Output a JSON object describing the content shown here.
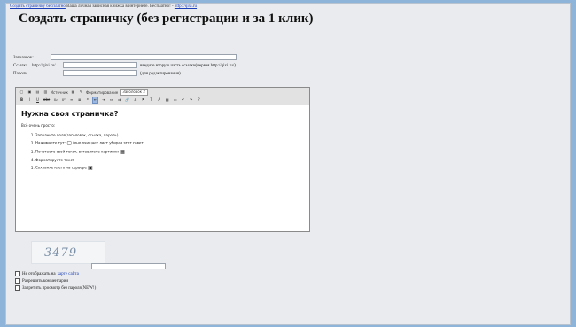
{
  "header": {
    "link1": "Создать страничку бесплатно",
    "tagline": "Ваша личная записная книжка в интернете. Бесплатно! -",
    "site_link": "http://qixi.ru"
  },
  "page_title": "Создать страничку (без регистрации и за 1 клик)",
  "form": {
    "title_label": "Заголовок:",
    "link_label": "Ссылка",
    "link_prefix": "http://qixi.ru/",
    "link_hint": "введите вторую часть ссылки(первая http://qixi.ru/)",
    "password_label": "Пароль",
    "password_hint": "(для редактирования)"
  },
  "toolbar": {
    "row1": {
      "source": "Источник",
      "format_label": "Форматирование",
      "heading_select": "Заголовок 2"
    },
    "row2": [
      "B",
      "I",
      "U",
      "abc",
      "x₂",
      "x²",
      "≡",
      "≣",
      "❝",
      "⇤",
      "⇥",
      "⇔",
      "⇉",
      "🔗",
      "⚓",
      "⚑",
      "T",
      "A",
      "▦",
      "▭",
      "↶",
      "↷",
      "?"
    ]
  },
  "editor": {
    "heading": "Нужна своя страничка?",
    "intro": "Всё очень просто:",
    "steps": [
      "Заполните поля(заголовок, ссылка, пароль)",
      "Нажимаете тут:",
      "Печатаете свой текст, вставляете картинки",
      "Форматируете текст",
      "Сохраняете его на сервере"
    ],
    "step2_tail": "(оно очищает лист убирая этот совет)"
  },
  "captcha": {
    "text": "3479"
  },
  "options": {
    "map_prefix": "Не отображать на",
    "map_link": "карте сайта",
    "comments": "Разрешить комментарии",
    "forbid_view": "Запретить просмотр без пароля(NEW!)"
  }
}
